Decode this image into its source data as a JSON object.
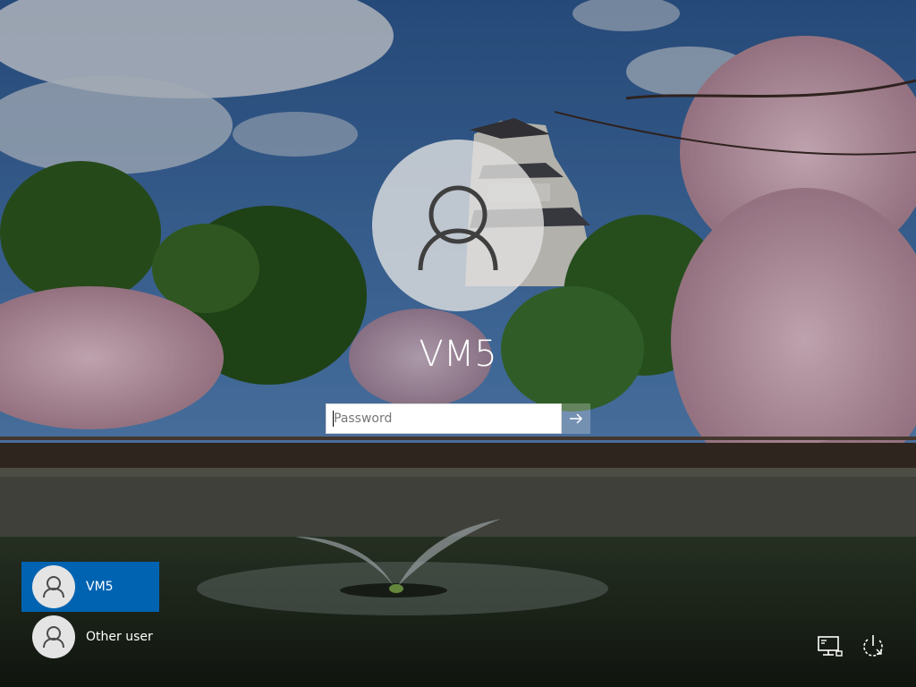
{
  "user": {
    "name": "VM5"
  },
  "password": {
    "placeholder": "Password",
    "value": ""
  },
  "submit": {
    "icon": "arrow-right-icon"
  },
  "user_list": [
    {
      "label": "VM5",
      "selected": true,
      "icon": "user-icon"
    },
    {
      "label": "Other user",
      "selected": false,
      "icon": "user-icon"
    }
  ],
  "corner_icons": {
    "network": "network-icon",
    "power": "power-icon"
  },
  "colors": {
    "selection": "#0063b1",
    "text": "#ffffff",
    "avatar": "#e4e4e4"
  }
}
